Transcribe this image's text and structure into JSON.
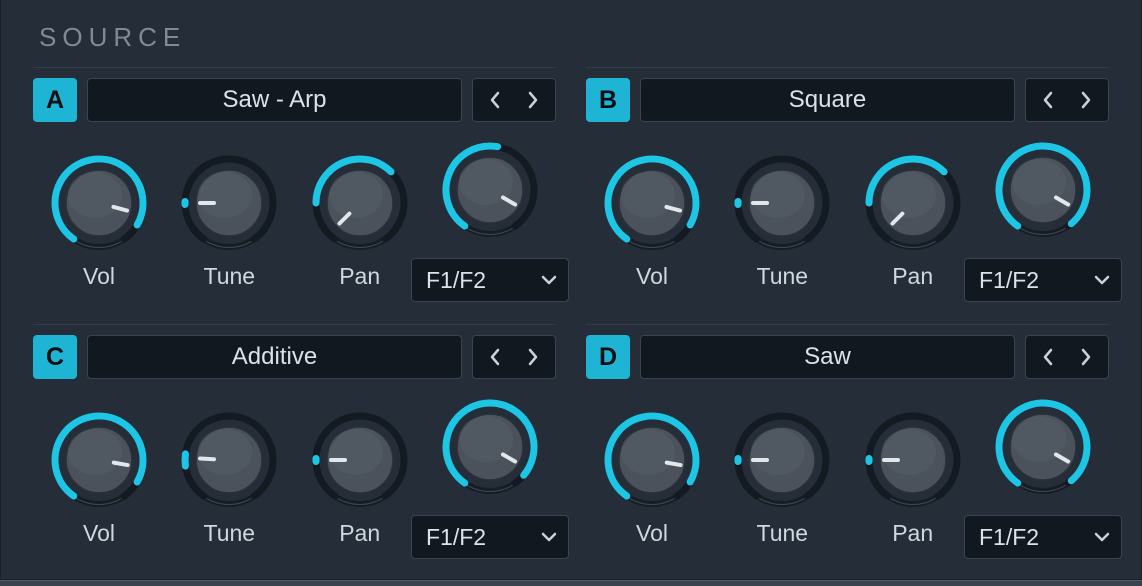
{
  "section_title": "SOURCE",
  "sources": [
    {
      "badge": "A",
      "name": "Saw - Arp",
      "route": "F1/F2",
      "knobs": [
        {
          "label": "Vol",
          "arc_start": 215,
          "arc_end": 480,
          "ptr": 105
        },
        {
          "label": "Tune",
          "arc_start": 268,
          "arc_end": 272,
          "ptr": 270
        },
        {
          "label": "Pan",
          "arc_start": 270,
          "arc_end": 405,
          "ptr": 225
        },
        {
          "label": "",
          "arc_start": 215,
          "arc_end": 370,
          "ptr": 120
        }
      ]
    },
    {
      "badge": "B",
      "name": "Square",
      "route": "F1/F2",
      "knobs": [
        {
          "label": "Vol",
          "arc_start": 215,
          "arc_end": 480,
          "ptr": 105
        },
        {
          "label": "Tune",
          "arc_start": 268,
          "arc_end": 272,
          "ptr": 270
        },
        {
          "label": "Pan",
          "arc_start": 270,
          "arc_end": 405,
          "ptr": 225
        },
        {
          "label": "",
          "arc_start": 215,
          "arc_end": 500,
          "ptr": 120
        }
      ]
    },
    {
      "badge": "C",
      "name": "Additive",
      "route": "F1/F2",
      "knobs": [
        {
          "label": "Vol",
          "arc_start": 215,
          "arc_end": 480,
          "ptr": 100
        },
        {
          "label": "Tune",
          "arc_start": 262,
          "arc_end": 278,
          "ptr": 273
        },
        {
          "label": "Pan",
          "arc_start": 268,
          "arc_end": 272,
          "ptr": 270
        },
        {
          "label": "",
          "arc_start": 215,
          "arc_end": 490,
          "ptr": 120
        }
      ]
    },
    {
      "badge": "D",
      "name": "Saw",
      "route": "F1/F2",
      "knobs": [
        {
          "label": "Vol",
          "arc_start": 215,
          "arc_end": 480,
          "ptr": 100
        },
        {
          "label": "Tune",
          "arc_start": 268,
          "arc_end": 272,
          "ptr": 270
        },
        {
          "label": "Pan",
          "arc_start": 268,
          "arc_end": 272,
          "ptr": 270
        },
        {
          "label": "",
          "arc_start": 215,
          "arc_end": 500,
          "ptr": 120
        }
      ]
    }
  ]
}
